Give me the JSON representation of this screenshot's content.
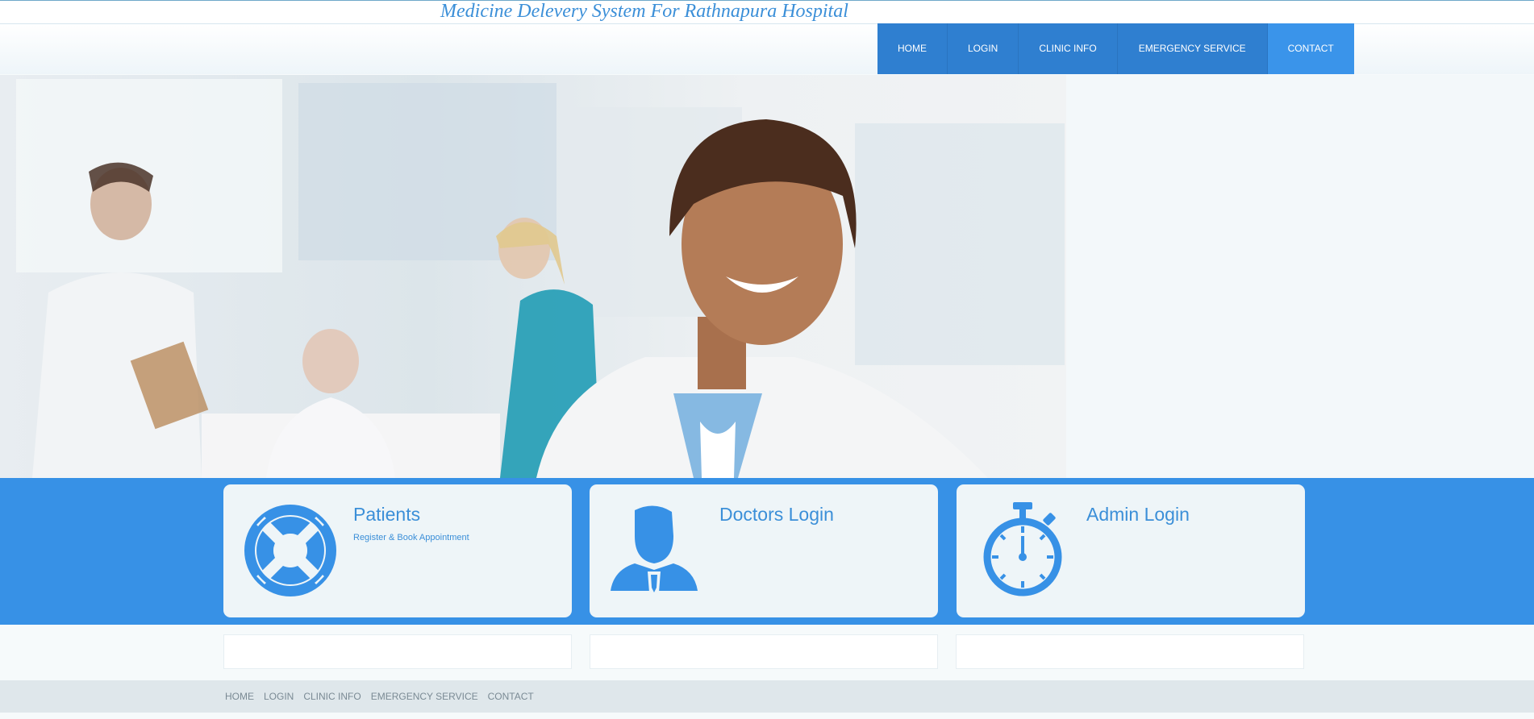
{
  "site": {
    "title": "Medicine Delevery System For Rathnapura Hospital"
  },
  "nav": [
    {
      "label": "HOME"
    },
    {
      "label": "LOGIN"
    },
    {
      "label": "CLINIC INFO"
    },
    {
      "label": "EMERGENCY SERVICE"
    },
    {
      "label": "CONTACT"
    }
  ],
  "cards": [
    {
      "title": "Patients",
      "subtitle": "Register & Book Appointment",
      "icon": "lifebuoy-icon"
    },
    {
      "title": "Doctors Login",
      "subtitle": "",
      "icon": "doctor-icon"
    },
    {
      "title": "Admin Login",
      "subtitle": "",
      "icon": "stopwatch-icon"
    }
  ],
  "footer": {
    "links": [
      "HOME",
      "LOGIN",
      "CLINIC INFO",
      "EMERGENCY SERVICE",
      "CONTACT"
    ]
  },
  "colors": {
    "accent": "#3791e6",
    "nav": "#2f7fd0",
    "nav_active": "#3a94ea",
    "title": "#3b8fd8"
  }
}
